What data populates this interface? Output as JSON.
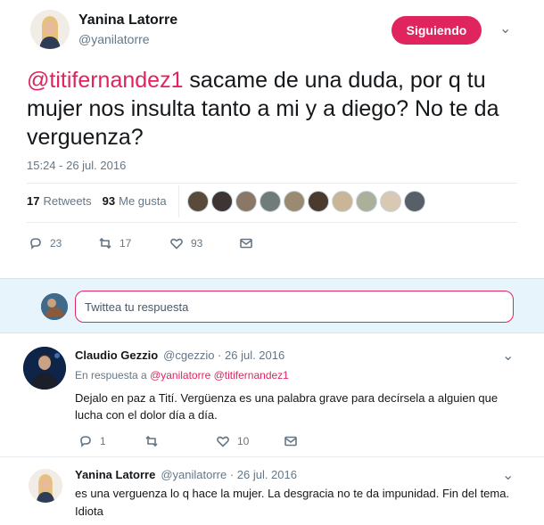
{
  "tweet": {
    "author_name": "Yanina Latorre",
    "author_handle": "@yanilatorre",
    "follow_label": "Siguiendo",
    "mention": "@titifernandez1",
    "text": " sacame de una duda, por q tu mujer nos insulta tanto a mi y a diego? No te da verguenza?",
    "time": "15:24 - 26 jul. 2016",
    "retweets_count": "17",
    "retweets_label": "Retweets",
    "likes_count": "93",
    "likes_label": "Me gusta",
    "actions": {
      "replies": "23",
      "retweets": "17",
      "likes": "93"
    }
  },
  "reply_box": {
    "placeholder": "Twittea tu respuesta"
  },
  "replies": [
    {
      "author_name": "Claudio Gezzio",
      "meta": "@cgezzio · 26 jul. 2016",
      "in_reply_label": "En respuesta a ",
      "in_reply_mentions": "@yanilatorre @titifernandez1",
      "text": "Dejalo en paz a Tití. Vergüenza es una palabra grave para decírsela a alguien que lucha con el dolor día a día.",
      "actions": {
        "replies": "1",
        "retweets": "",
        "likes": "10"
      }
    },
    {
      "author_name": "Yanina Latorre",
      "meta": "@yanilatorre · 26 jul. 2016",
      "text": "es una verguenza lo q hace la mujer. La desgracia no te da impunidad. Fin del tema. Idiota"
    }
  ],
  "colors": {
    "accent": "#e0245e",
    "secondary_text": "#657786",
    "primary_text": "#14171a",
    "reply_bg": "#e8f4fc"
  }
}
